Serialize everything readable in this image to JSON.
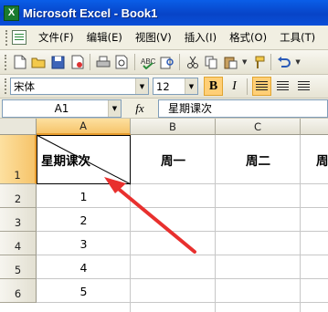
{
  "window": {
    "title": "Microsoft Excel - Book1",
    "app_icon_glyph": "X"
  },
  "menu": [
    "文件(F)",
    "编辑(E)",
    "视图(V)",
    "插入(I)",
    "格式(O)",
    "工具(T)"
  ],
  "toolbar": {
    "icons": [
      "new-file-icon",
      "open-folder-icon",
      "save-icon",
      "permission-icon",
      "print-icon",
      "print-preview-icon",
      "spelling-icon",
      "research-icon",
      "cut-icon",
      "copy-icon",
      "paste-icon",
      "format-painter-icon",
      "undo-icon"
    ]
  },
  "format_bar": {
    "font_name": "宋体",
    "font_size": "12",
    "bold_label": "B",
    "italic_label": "I",
    "bold_active": true
  },
  "formula_bar": {
    "name_box": "A1",
    "fx_label": "fx",
    "content": "星期课次"
  },
  "sheet": {
    "columns": [
      "A",
      "B",
      "C",
      "D"
    ],
    "rows": [
      "1",
      "2",
      "3",
      "4",
      "5",
      "6"
    ],
    "cells": {
      "A1": "星期课次",
      "B1": "周一",
      "C1": "周二",
      "D1": "周",
      "A2": "1",
      "A3": "2",
      "A4": "3",
      "A5": "4",
      "A6": "5"
    },
    "selected_cell": "A1"
  },
  "colors": {
    "arrow": "#e8302e",
    "selection": "#f6c46a",
    "title_bar": "#0a5ee8"
  }
}
